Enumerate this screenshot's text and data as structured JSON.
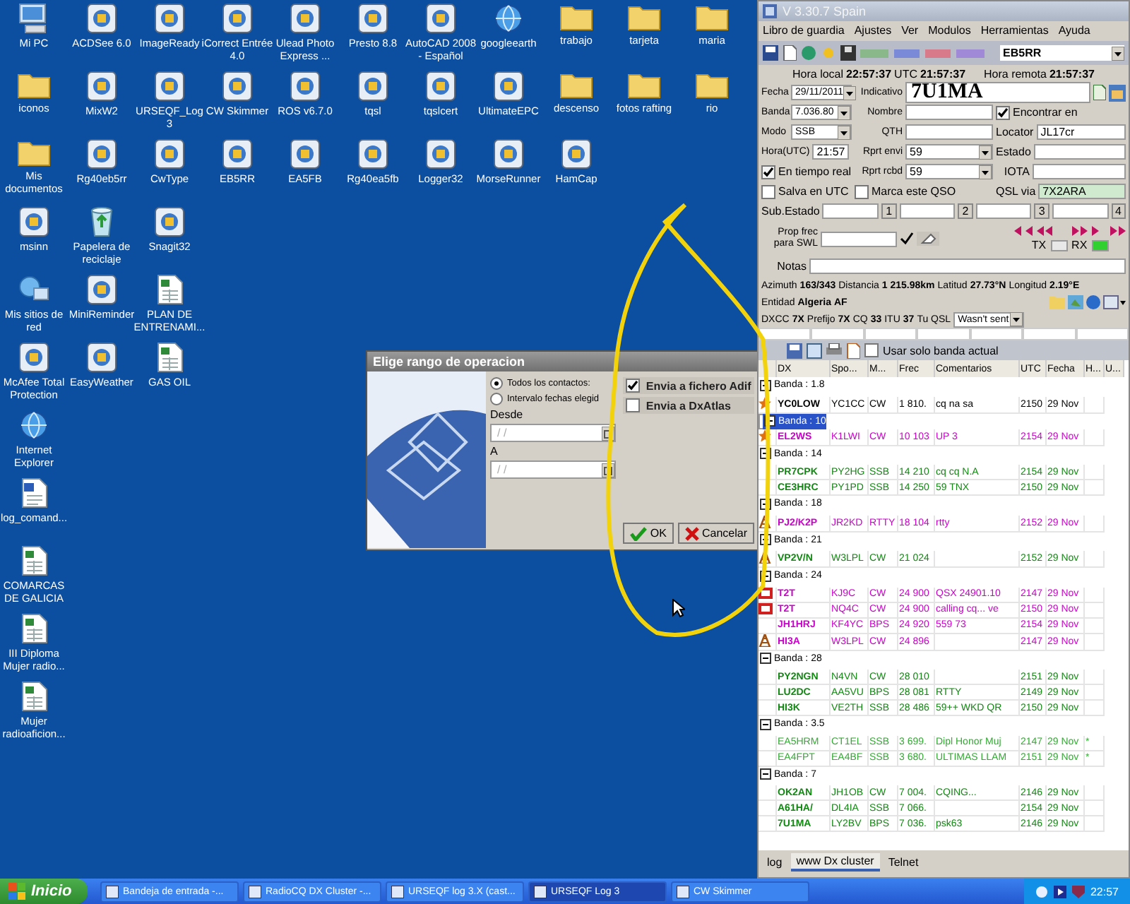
{
  "desktop": {
    "icon_columns": [
      [
        {
          "label": "Mi PC",
          "kind": "computer"
        },
        {
          "label": "iconos",
          "kind": "folder"
        },
        {
          "label": "Mis documentos",
          "kind": "folder"
        },
        {
          "label": "msinn",
          "kind": "program"
        },
        {
          "label": "Mis sitios de red",
          "kind": "network"
        },
        {
          "label": "McAfee Total Protection",
          "kind": "program"
        },
        {
          "label": "Internet Explorer",
          "kind": "browser"
        },
        {
          "label": "log_comand...",
          "kind": "document"
        },
        {
          "label": "COMARCAS DE GALICIA",
          "kind": "spreadsheet"
        },
        {
          "label": "III Diploma Mujer radio...",
          "kind": "spreadsheet"
        },
        {
          "label": "Mujer radioaficion...",
          "kind": "spreadsheet"
        }
      ],
      [
        {
          "label": "ACDSee 6.0",
          "kind": "program"
        },
        {
          "label": "MixW2",
          "kind": "program"
        },
        {
          "label": "Rg40eb5rr",
          "kind": "program"
        },
        {
          "label": "Papelera de reciclaje",
          "kind": "recycle"
        },
        {
          "label": "MiniReminder",
          "kind": "program"
        },
        {
          "label": "EasyWeather",
          "kind": "program"
        }
      ],
      [
        {
          "label": "ImageReady",
          "kind": "program"
        },
        {
          "label": "URSEQF_Log 3",
          "kind": "program"
        },
        {
          "label": "CwType",
          "kind": "program"
        },
        {
          "label": "Snagit32",
          "kind": "program"
        },
        {
          "label": "PLAN DE ENTRENAMI...",
          "kind": "spreadsheet"
        },
        {
          "label": "GAS OIL",
          "kind": "spreadsheet"
        }
      ],
      [
        {
          "label": "iCorrect Entrée 4.0",
          "kind": "program"
        },
        {
          "label": "CW Skimmer",
          "kind": "program"
        },
        {
          "label": "EB5RR",
          "kind": "program"
        }
      ],
      [
        {
          "label": "Ulead Photo Express ...",
          "kind": "program"
        },
        {
          "label": "ROS v6.7.0",
          "kind": "program"
        },
        {
          "label": "EA5FB",
          "kind": "program"
        }
      ],
      [
        {
          "label": "Presto 8.8",
          "kind": "program"
        },
        {
          "label": "tqsl",
          "kind": "program"
        },
        {
          "label": "Rg40ea5fb",
          "kind": "program"
        }
      ],
      [
        {
          "label": "AutoCAD 2008 - Español",
          "kind": "program"
        },
        {
          "label": "tqslcert",
          "kind": "program"
        },
        {
          "label": "Logger32",
          "kind": "program"
        }
      ],
      [
        {
          "label": "googleearth",
          "kind": "browser"
        },
        {
          "label": "UltimateEPC",
          "kind": "program"
        },
        {
          "label": "MorseRunner",
          "kind": "program"
        }
      ],
      [
        {
          "label": "trabajo",
          "kind": "folder"
        },
        {
          "label": "descenso",
          "kind": "folder"
        },
        {
          "label": "HamCap",
          "kind": "program"
        }
      ],
      [
        {
          "label": "tarjeta",
          "kind": "folder"
        },
        {
          "label": "fotos rafting",
          "kind": "folder"
        }
      ],
      [
        {
          "label": "maria",
          "kind": "folder"
        },
        {
          "label": "rio",
          "kind": "folder"
        }
      ]
    ]
  },
  "dialog": {
    "title": "Elige rango de operacion",
    "options": [
      {
        "label": "Todos los contactos:",
        "selected": true
      },
      {
        "label": "Intervalo fechas elegid",
        "selected": false
      }
    ],
    "from_label": "Desde",
    "from_value": "/ /",
    "to_label": "A",
    "to_value": "/ /",
    "checks": [
      {
        "label": "Envia a fichero Adif",
        "checked": true
      },
      {
        "label": "Envia a DxAtlas",
        "checked": false
      }
    ],
    "buttons": [
      "OK",
      "Cancelar"
    ]
  },
  "app": {
    "title": "V 3.30.7 Spain",
    "menu": [
      "Libro de guardia",
      "Ajustes",
      "Ver",
      "Modulos",
      "Herramientas",
      "Ayuda"
    ],
    "station": "EB5RR",
    "clock": {
      "local_label": "Hora local",
      "local": "22:57:37",
      "utc_label": "UTC",
      "utc": "21:57:37",
      "remote_label": "Hora remota",
      "remote": "21:57:37"
    },
    "fecha": {
      "label": "Fecha",
      "value": "29/11/2011"
    },
    "banda": {
      "label": "Banda",
      "value": "7.036.80"
    },
    "modo": {
      "label": "Modo",
      "value": "SSB"
    },
    "hora": {
      "label": "Hora(UTC)",
      "value": "21:57"
    },
    "indicativo": {
      "label": "Indicativo",
      "value": "7U1MA"
    },
    "nombre": {
      "label": "Nombre"
    },
    "qth": {
      "label": "QTH"
    },
    "rprt_envi": {
      "label": "Rprt envi",
      "value": "59"
    },
    "rprt_rcbd": {
      "label": "Rprt rcbd",
      "value": "59"
    },
    "encontrar": {
      "label": "Encontrar en",
      "checked": true
    },
    "locator": {
      "label": "Locator",
      "value": "JL17cr"
    },
    "estado": {
      "label": "Estado"
    },
    "iota": {
      "label": "IOTA"
    },
    "tiempo_real": {
      "label": "En tiempo real",
      "checked": true
    },
    "salva_utc": {
      "label": "Salva en UTC",
      "checked": false
    },
    "marca_qso": {
      "label": "Marca este QSO",
      "checked": false
    },
    "qsl_via": {
      "label": "QSL via",
      "value": "7X2ARA"
    },
    "sub_estado": {
      "label": "Sub.Estado",
      "buttons": [
        "1",
        "2",
        "3",
        "4"
      ]
    },
    "swl": {
      "label": "Prop frec para SWL"
    },
    "indicators": [
      {
        "label": "TX",
        "on": false
      },
      {
        "label": "RX",
        "on": true
      }
    ],
    "notas": {
      "label": "Notas"
    },
    "info_rows": [
      [
        {
          "label": "Azimuth",
          "value": "163/343",
          "kind": "pair"
        },
        {
          "label": "Distancia",
          "value": "1 215.98km",
          "kind": "pair"
        },
        {
          "label": "Latitud",
          "value": "27.73°N",
          "kind": "pair"
        },
        {
          "label": "Longitud",
          "value": "2.19°E",
          "kind": "pair"
        }
      ],
      [
        {
          "label": "Entidad",
          "value": "Algeria",
          "kind": "pair"
        },
        {
          "value": "AF",
          "kind": "pair"
        }
      ],
      [
        {
          "label": "DXCC",
          "value": "7X",
          "kind": "pair"
        },
        {
          "label": "Prefijo",
          "value": "7X",
          "kind": "pair"
        },
        {
          "label": "CQ",
          "value": "33",
          "kind": "pair"
        },
        {
          "label": "ITU",
          "value": "37",
          "kind": "pair"
        },
        {
          "label": "Tu QSL",
          "value": "Wasn't sent",
          "kind": "select"
        }
      ]
    ],
    "only_current_band": {
      "label": "Usar solo banda actual",
      "checked": false
    },
    "columns": [
      "DX",
      "Spo...",
      "M...",
      "Frec",
      "Comentarios",
      "UTC",
      "Fecha",
      "H...",
      "U..."
    ],
    "groups": [
      {
        "label": "Banda : 1.8",
        "selected": false,
        "spots": [
          {
            "dx": "YC0LOW",
            "spotter": "YC1CC",
            "mode": "CW",
            "freq": "1 810.",
            "comment": "cq na sa",
            "utc": "2150",
            "date": "29 Nov",
            "color": "#000000",
            "bold": true,
            "kind": "star"
          }
        ]
      },
      {
        "label": "Banda : 10",
        "selected": true,
        "spots": [
          {
            "dx": "EL2WS",
            "spotter": "K1LWI",
            "mode": "CW",
            "freq": "10 103",
            "comment": "UP 3",
            "utc": "2154",
            "date": "29 Nov",
            "color": "#cc00cc",
            "bold": true,
            "kind": "star"
          }
        ]
      },
      {
        "label": "Banda : 14",
        "selected": false,
        "spots": [
          {
            "dx": "PR7CPK",
            "spotter": "PY2HG",
            "mode": "SSB",
            "freq": "14 210",
            "comment": "cq cq  N.A",
            "utc": "2154",
            "date": "29 Nov",
            "color": "#118811",
            "bold": true,
            "kind": "plain"
          },
          {
            "dx": "CE3HRC",
            "spotter": "PY1PD",
            "mode": "SSB",
            "freq": "14 250",
            "comment": "59 TNX",
            "utc": "2150",
            "date": "29 Nov",
            "color": "#118811",
            "bold": true,
            "kind": "plain"
          }
        ]
      },
      {
        "label": "Banda : 18",
        "selected": false,
        "spots": [
          {
            "dx": "PJ2/K2P",
            "spotter": "JR2KD",
            "mode": "RTTY",
            "freq": "18 104",
            "comment": "rtty",
            "utc": "2152",
            "date": "29 Nov",
            "color": "#cc00cc",
            "bold": true,
            "kind": "antenna"
          }
        ]
      },
      {
        "label": "Banda : 21",
        "selected": false,
        "spots": [
          {
            "dx": "VP2V/N",
            "spotter": "W3LPL",
            "mode": "CW",
            "freq": "21 024",
            "utc": "2152",
            "date": "29 Nov",
            "color": "#118811",
            "bold": true,
            "kind": "antenna"
          }
        ]
      },
      {
        "label": "Banda : 24",
        "selected": false,
        "spots": [
          {
            "dx": "T2T",
            "spotter": "KJ9C",
            "mode": "CW",
            "freq": "24 900",
            "comment": "QSX 24901.10",
            "utc": "2147",
            "date": "29 Nov",
            "color": "#cc00cc",
            "bold": true,
            "kind": "card"
          },
          {
            "dx": "T2T",
            "spotter": "NQ4C",
            "mode": "CW",
            "freq": "24 900",
            "comment": "calling cq... ve",
            "utc": "2150",
            "date": "29 Nov",
            "color": "#cc00cc",
            "bold": true,
            "kind": "card"
          },
          {
            "dx": "JH1HRJ",
            "spotter": "KF4YC",
            "mode": "BPS",
            "freq": "24 920",
            "comment": "559  73",
            "utc": "2154",
            "date": "29 Nov",
            "color": "#cc00cc",
            "bold": true,
            "kind": "plain"
          },
          {
            "dx": "HI3A",
            "spotter": "W3LPL",
            "mode": "CW",
            "freq": "24 896",
            "utc": "2147",
            "date": "29 Nov",
            "color": "#cc00cc",
            "bold": true,
            "kind": "antenna"
          }
        ]
      },
      {
        "label": "Banda : 28",
        "selected": false,
        "spots": [
          {
            "dx": "PY2NGN",
            "spotter": "N4VN",
            "mode": "CW",
            "freq": "28 010",
            "utc": "2151",
            "date": "29 Nov",
            "color": "#118811",
            "bold": true,
            "kind": "plain"
          },
          {
            "dx": "LU2DC",
            "spotter": "AA5VU",
            "mode": "BPS",
            "freq": "28 081",
            "comment": "RTTY",
            "utc": "2149",
            "date": "29 Nov",
            "color": "#118811",
            "bold": true,
            "kind": "plain"
          },
          {
            "dx": "HI3K",
            "spotter": "VE2TH",
            "mode": "SSB",
            "freq": "28 486",
            "comment": "59++ WKD QR",
            "utc": "2150",
            "date": "29 Nov",
            "color": "#118811",
            "bold": true,
            "kind": "plain"
          }
        ]
      },
      {
        "label": "Banda : 3.5",
        "selected": false,
        "spots": [
          {
            "dx": "EA5HRM",
            "spotter": "CT1EL",
            "mode": "SSB",
            "freq": "3 699.",
            "comment": "Dipl Honor Muj",
            "utc": "2147",
            "date": "29 Nov",
            "h": "*",
            "color": "#33aa33",
            "bold": false,
            "kind": "plain"
          },
          {
            "dx": "EA4FPT",
            "spotter": "EA4BF",
            "mode": "SSB",
            "freq": "3 680.",
            "comment": "ULTIMAS LLAM",
            "utc": "2151",
            "date": "29 Nov",
            "h": "*",
            "color": "#33aa33",
            "bold": false,
            "kind": "plain"
          }
        ]
      },
      {
        "label": "Banda : 7",
        "selected": false,
        "spots": [
          {
            "dx": "OK2AN",
            "spotter": "JH1OB",
            "mode": "CW",
            "freq": "7 004.",
            "comment": "CQING...",
            "utc": "2146",
            "date": "29 Nov",
            "color": "#118811",
            "bold": true,
            "kind": "plain"
          },
          {
            "dx": "A61HA/",
            "spotter": "DL4IA",
            "mode": "SSB",
            "freq": "7 066.",
            "utc": "2154",
            "date": "29 Nov",
            "color": "#118811",
            "bold": true,
            "kind": "plain"
          },
          {
            "dx": "7U1MA",
            "spotter": "LY2BV",
            "mode": "BPS",
            "freq": "7 036.",
            "comment": "psk63",
            "utc": "2146",
            "date": "29 Nov",
            "color": "#118811",
            "bold": true,
            "kind": "plain"
          }
        ]
      }
    ],
    "tabs": [
      {
        "label": "log",
        "selected": false
      },
      {
        "label": "www Dx cluster",
        "selected": true
      },
      {
        "label": "Telnet",
        "selected": false
      }
    ]
  },
  "taskbar": {
    "start": "Inicio",
    "tasks": [
      {
        "label": "Bandeja de entrada -...",
        "selected": false
      },
      {
        "label": "RadioCQ DX Cluster -...",
        "selected": false
      },
      {
        "label": "URSEQF log 3.X (cast...",
        "selected": false
      },
      {
        "label": "URSEQF Log 3",
        "selected": true
      },
      {
        "label": "CW Skimmer",
        "selected": false
      }
    ],
    "clock": "22:57"
  }
}
